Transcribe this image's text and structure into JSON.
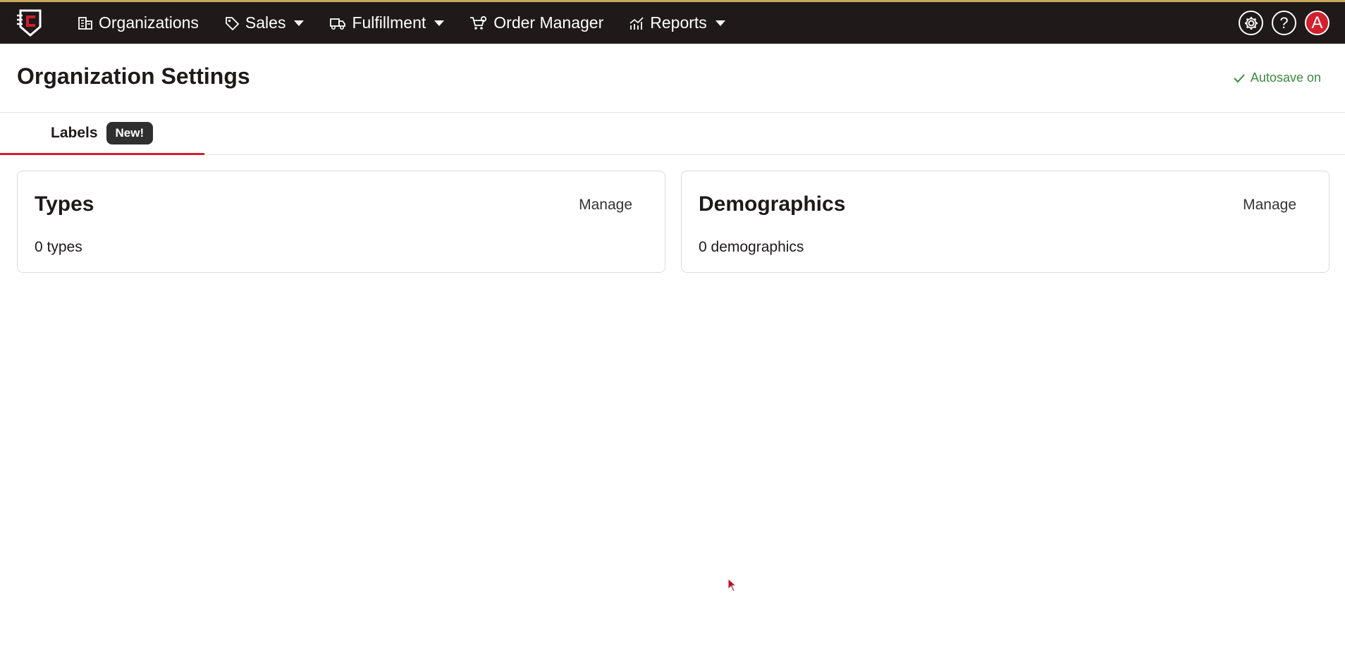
{
  "topnav": {
    "items": [
      {
        "label": "Organizations",
        "icon": "building-icon",
        "dropdown": false
      },
      {
        "label": "Sales",
        "icon": "tag-icon",
        "dropdown": true
      },
      {
        "label": "Fulfillment",
        "icon": "truck-icon",
        "dropdown": true
      },
      {
        "label": "Order Manager",
        "icon": "cart-gear-icon",
        "dropdown": false
      },
      {
        "label": "Reports",
        "icon": "chart-icon",
        "dropdown": true
      }
    ],
    "help_label": "?",
    "avatar_label": "A",
    "colors": {
      "bar": "#1f1919",
      "accent": "#d21f2d"
    }
  },
  "header": {
    "title": "Organization Settings",
    "autosave": "Autosave on"
  },
  "tabs": [
    {
      "label": "Labels",
      "badge": "New!",
      "active": true
    }
  ],
  "cards": [
    {
      "title": "Types",
      "action": "Manage",
      "count": "0 types"
    },
    {
      "title": "Demographics",
      "action": "Manage",
      "count": "0 demographics"
    }
  ]
}
